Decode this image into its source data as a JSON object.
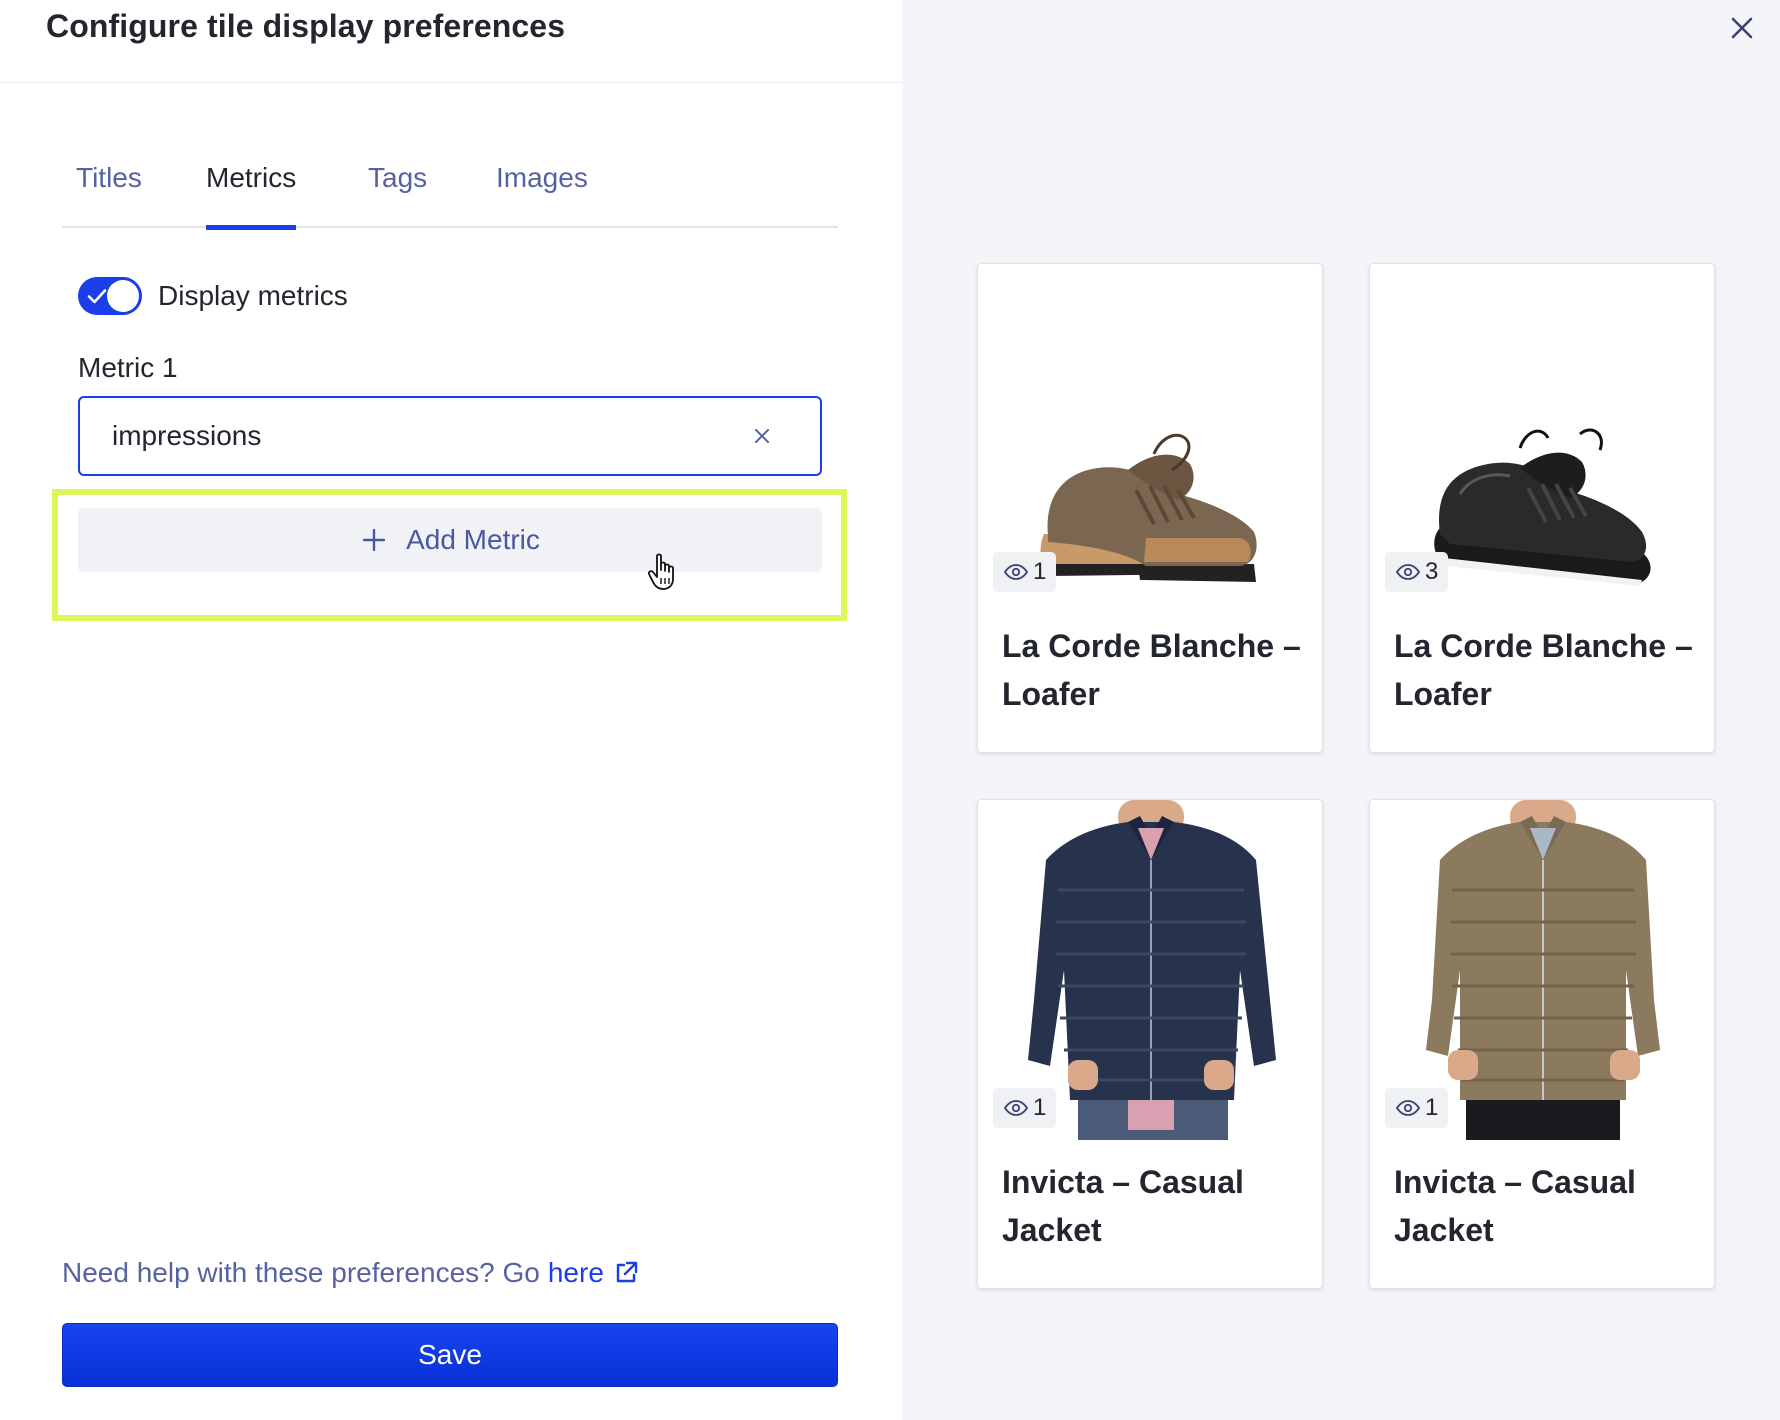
{
  "dialog": {
    "title": "Configure tile display preferences"
  },
  "tabs": [
    {
      "label": "Titles",
      "active": false
    },
    {
      "label": "Metrics",
      "active": true
    },
    {
      "label": "Tags",
      "active": false
    },
    {
      "label": "Images",
      "active": false
    }
  ],
  "metrics_tab": {
    "toggle_label": "Display metrics",
    "toggle_on": true,
    "metric_1_label": "Metric 1",
    "metric_1_value": "impressions",
    "add_metric_label": "Add Metric"
  },
  "footer": {
    "help_text": "Need help with these preferences? Go",
    "help_link": "here",
    "save_label": "Save"
  },
  "preview": {
    "tiles": [
      {
        "title": "La Corde Blanche – Loafer",
        "metric": "1",
        "image": "brown-loafer"
      },
      {
        "title": "La Corde Blanche – Loafer",
        "metric": "3",
        "image": "black-loafer"
      },
      {
        "title": "Invicta – Casual Jacket",
        "metric": "1",
        "image": "navy-puffer-jacket"
      },
      {
        "title": "Invicta – Casual Jacket",
        "metric": "1",
        "image": "olive-puffer-jacket"
      }
    ]
  },
  "colors": {
    "accent": "#1a3ee8",
    "highlight": "#dcf75b",
    "panel_bg": "#f5f5f9",
    "tab_inactive": "#5563a0"
  }
}
